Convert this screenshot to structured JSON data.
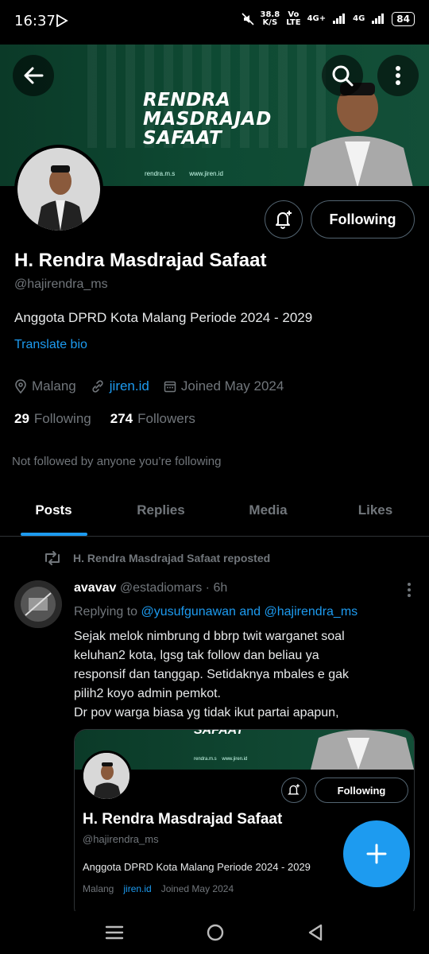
{
  "status_bar": {
    "time": "16:37",
    "speed_value": "38.8",
    "speed_unit": "K/S",
    "network1_top": "Vo",
    "network1_bottom": "LTE",
    "network2": "4G+",
    "network3": "4G",
    "battery": "84"
  },
  "banner": {
    "title_line1": "RENDRA",
    "title_line2": "MASDRAJAD",
    "title_line3": "SAFAAT",
    "footer_ig": "rendra.m.s",
    "footer_web": "www.jiren.id",
    "colors": {
      "green": "#0e4a33"
    }
  },
  "profile": {
    "name": "H. Rendra Masdrajad Safaat",
    "handle": "@hajirendra_ms",
    "bio": "Anggota DPRD Kota Malang Periode 2024 - 2029",
    "translate_label": "Translate bio",
    "location": "Malang",
    "website": "jiren.id",
    "joined": "Joined May 2024",
    "following_count": "29",
    "following_label": "Following",
    "followers_count": "274",
    "followers_label": "Followers",
    "follow_button_label": "Following",
    "not_followed_text": "Not followed by anyone you’re following"
  },
  "tabs": [
    {
      "label": "Posts",
      "active": true
    },
    {
      "label": "Replies",
      "active": false
    },
    {
      "label": "Media",
      "active": false
    },
    {
      "label": "Likes",
      "active": false
    }
  ],
  "tweet": {
    "repost_label": "H. Rendra Masdrajad Safaat reposted",
    "author_name": "avavav",
    "author_meta": "@estadiomars · 6h",
    "reply_prefix": "Replying to",
    "reply_targets": "@yusufgunawan and @hajirendra_ms",
    "text_line1": "Sejak melok nimbrung d bbrp twit warganet soal",
    "text_line2": "keluhan2 kota, lgsg tak follow dan beliau ya",
    "text_line3": "responsif dan tanggap. Setidaknya mbales e gak",
    "text_line4": "pilih2 koyo admin pemkot.",
    "text_line5": "Dr pov warga biasa yg tidak ikut partai apapun,"
  },
  "card": {
    "banner_text": "SAFAAT",
    "footer_ig": "rendra.m.s",
    "footer_web": "www.jiren.id",
    "follow_label": "Following",
    "name": "H. Rendra Masdrajad Safaat",
    "handle": "@hajirendra_ms",
    "bio": "Anggota DPRD Kota Malang Periode 2024 - 2029",
    "location": "Malang",
    "website": "jiren.id",
    "joined": "Joined May 2024"
  },
  "colors": {
    "accent": "#1d9bf0",
    "muted": "#71767b",
    "bg": "#000000"
  }
}
